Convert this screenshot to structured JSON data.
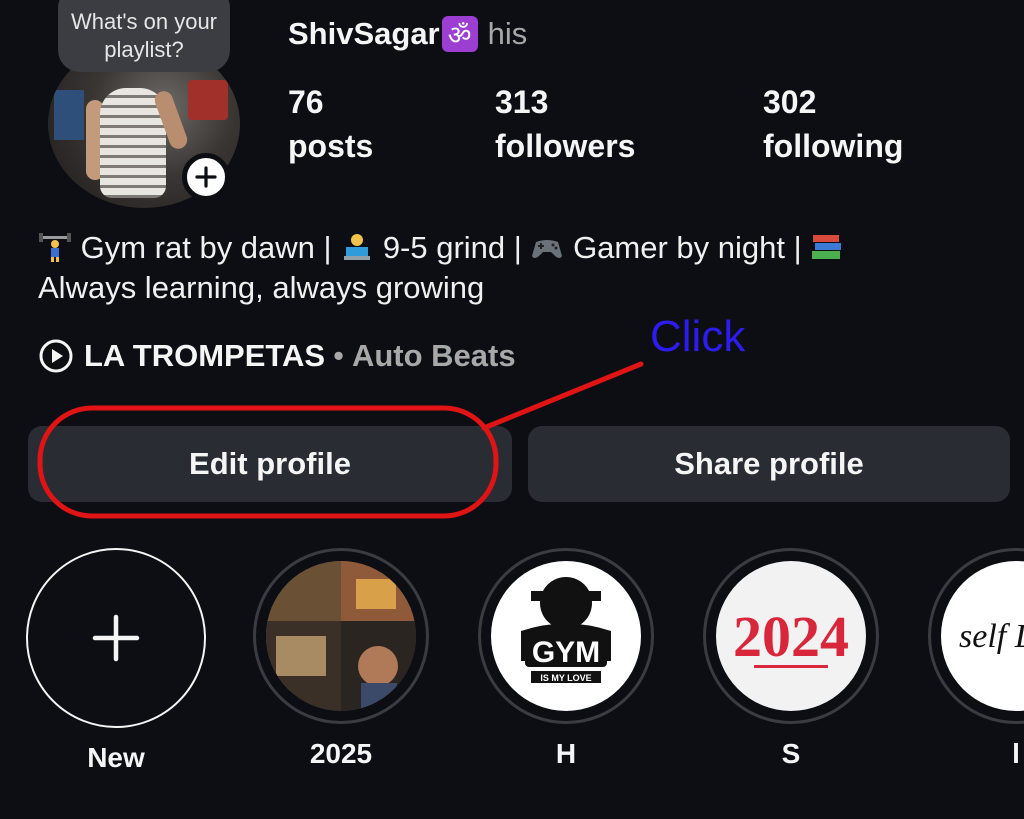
{
  "profile": {
    "note_text": "What's on your playlist?",
    "username": "ShivSagar",
    "username_badge": "ॐ",
    "pronoun": "his"
  },
  "stats": [
    {
      "value": "76",
      "label": "posts"
    },
    {
      "value": "313",
      "label": "followers"
    },
    {
      "value": "302",
      "label": "following"
    }
  ],
  "bio": {
    "part1": " Gym rat by dawn | ",
    "part2": " 9-5 grind | ",
    "part3": " Gamer by night | ",
    "line2": "Always learning, always growing"
  },
  "music": {
    "title": "LA TROMPETAS",
    "separator": "•",
    "artist": "Auto Beats"
  },
  "buttons": {
    "edit_profile": "Edit profile",
    "share_profile": "Share profile"
  },
  "annotation": {
    "label": "Click",
    "color": "#2d1cf0",
    "highlight_color": "#e01414"
  },
  "highlights": [
    {
      "label": "New"
    },
    {
      "label": "2025"
    },
    {
      "label": "H",
      "cover_text": "GYM",
      "cover_subtext": "IS MY LOVE"
    },
    {
      "label": "S",
      "cover_text": "2024"
    },
    {
      "label": "l",
      "cover_text": "self LO"
    }
  ]
}
